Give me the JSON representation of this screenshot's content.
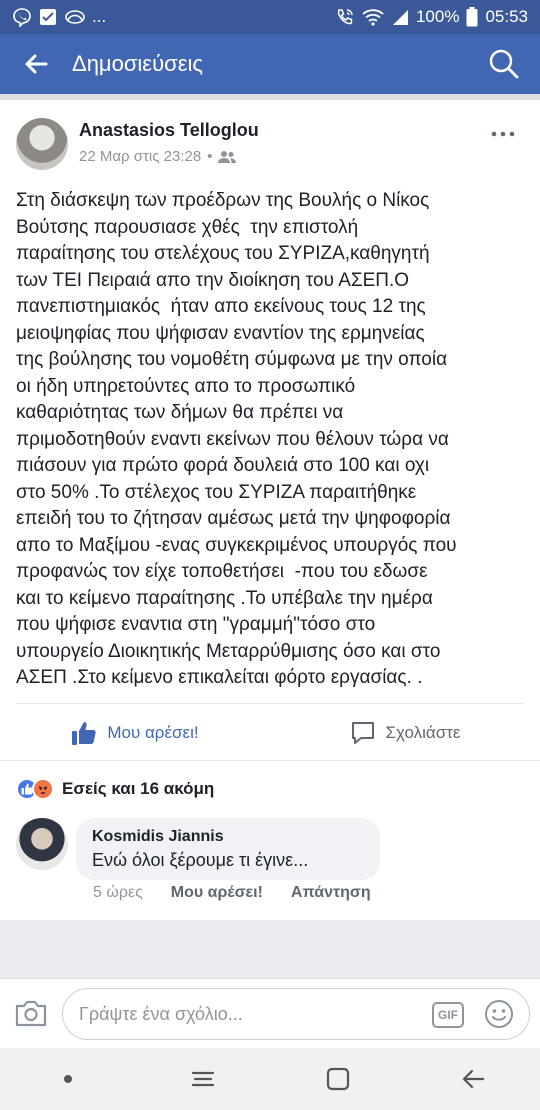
{
  "status_bar": {
    "left_icons": [
      "viber-icon",
      "message-icon",
      "sync-icon"
    ],
    "ellipsis": "...",
    "battery": "100%",
    "time": "05:53"
  },
  "header": {
    "title": "Δημοσιεύσεις"
  },
  "post": {
    "author": "Anastasios Telloglou",
    "timestamp": "22 Μαρ στις 23:28",
    "separator": "•",
    "audience_icon": "friends-icon",
    "text": "Στη διάσκεψη των προέδρων της Βουλής ο Νίκος\nΒούτσης παρουσιασε χθές  την επιστολή\nπαραίτησης του στελέχους του ΣΥΡΙΖΑ,καθηγητή\nτων ΤΕΙ Πειραιά απο την διοίκηση του ΑΣΕΠ.Ο\nπανεπιστημιακός  ήταν απο εκείνους τους 12 της\nμειοψηφίας που ψήφισαν εναντίον της ερμηνείας\nτης βούλησης του νομοθέτη σύμφωνα με την οποία\nοι ήδη υπηρετούντες απο το προσωπικό\nκαθαριότητας των δήμων θα πρέπει να\nπριμοδοτηθούν εναντι εκείνων που θέλουν τώρα να\nπιάσουν για πρώτο φορά δουλειά στο 100 και οχι\nστο 50% .Το στέλεχος του ΣΥΡΙΖΑ παραιτήθηκε\nεπειδή του το ζήτησαν αμέσως μετά την ψηφοφορία\nαπο το Μαξίμου -ενας συγκεκριμένος υπουργός που\nπροφανώς τον είχε τοποθετήσει  -που του εδωσε\nκαι το κείμενο παραίτησης .Το υπέβαλε την ημέρα\nπου ψήφισε εναντια στη \"γραμμή\"τόσο στο\nυπουργείο Διοικητικής Μεταρρύθμισης όσο και στο\nΑΣΕΠ .Στο κείμενο επικαλείται φόρτο εργασίας. .",
    "like_label": "Μου αρέσει!",
    "comment_label": "Σχολιάστε",
    "reactions_summary": "Εσείς και 16 ακόμη"
  },
  "comment": {
    "author": "Kosmidis Jiannis",
    "text": "Ενώ όλοι ξέρουμε τι έγινε...",
    "age": "5 ώρες",
    "like_label": "Μου αρέσει!",
    "reply_label": "Απάντηση"
  },
  "composer": {
    "placeholder": "Γράψτε ένα σχόλιο...",
    "gif_label": "GIF"
  },
  "colors": {
    "brand": "#4267b2",
    "status_bar": "#3b5998",
    "like_blue": "#4267b2",
    "angry": "#f0764a"
  }
}
